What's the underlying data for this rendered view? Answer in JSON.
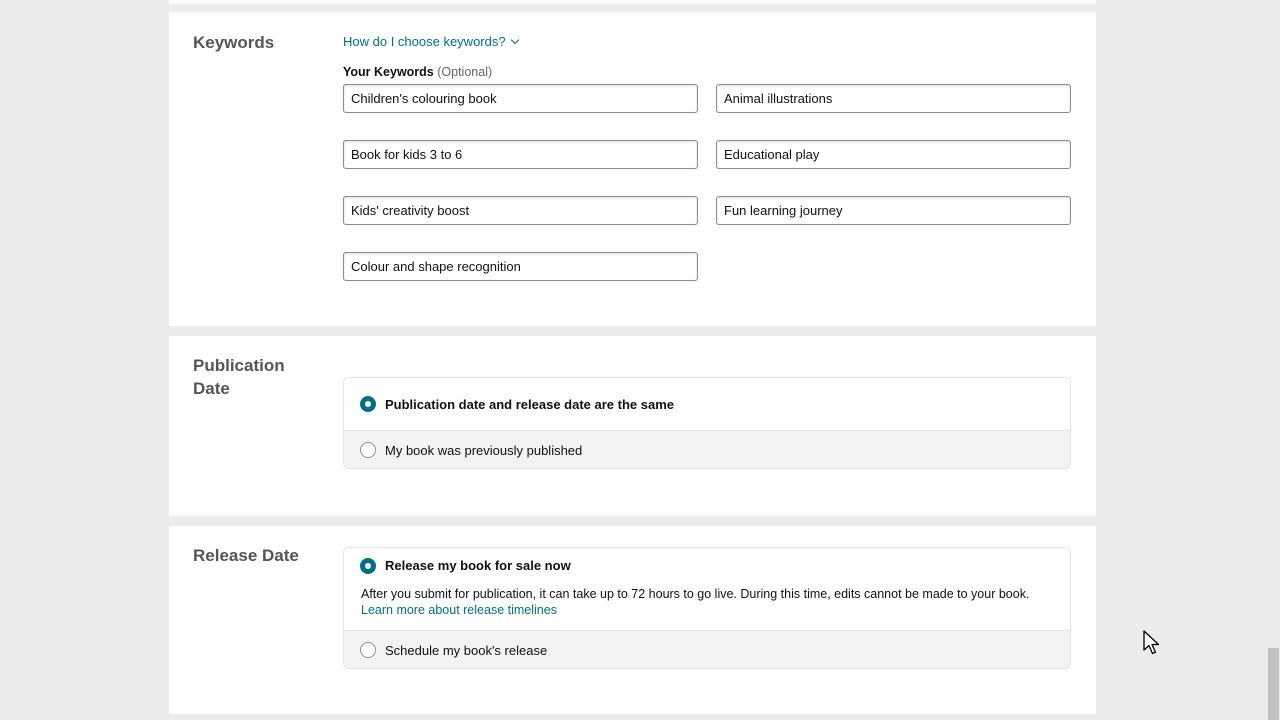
{
  "keywords": {
    "title": "Keywords",
    "help_link": "How do I choose keywords?",
    "label": "Your Keywords",
    "optional": "(Optional)",
    "values": [
      "Children's colouring book",
      "Animal illustrations",
      "Book for kids 3 to 6",
      "Educational play",
      "Kids' creativity boost",
      "Fun learning journey",
      "Colour and shape recognition"
    ]
  },
  "publication_date": {
    "title": "Publication Date",
    "option_same": "Publication date and release date are the same",
    "option_previous": "My book was previously published",
    "selected": "same"
  },
  "release_date": {
    "title": "Release Date",
    "option_now": "Release my book for sale now",
    "note": "After you submit for publication, it can take up to 72 hours to go live. During this time, edits cannot be made to your book.",
    "learn_more": "Learn more about release timelines",
    "option_schedule": "Schedule my book's release",
    "selected": "now"
  },
  "colors": {
    "accent": "#007185",
    "page_bg": "#ececec"
  }
}
